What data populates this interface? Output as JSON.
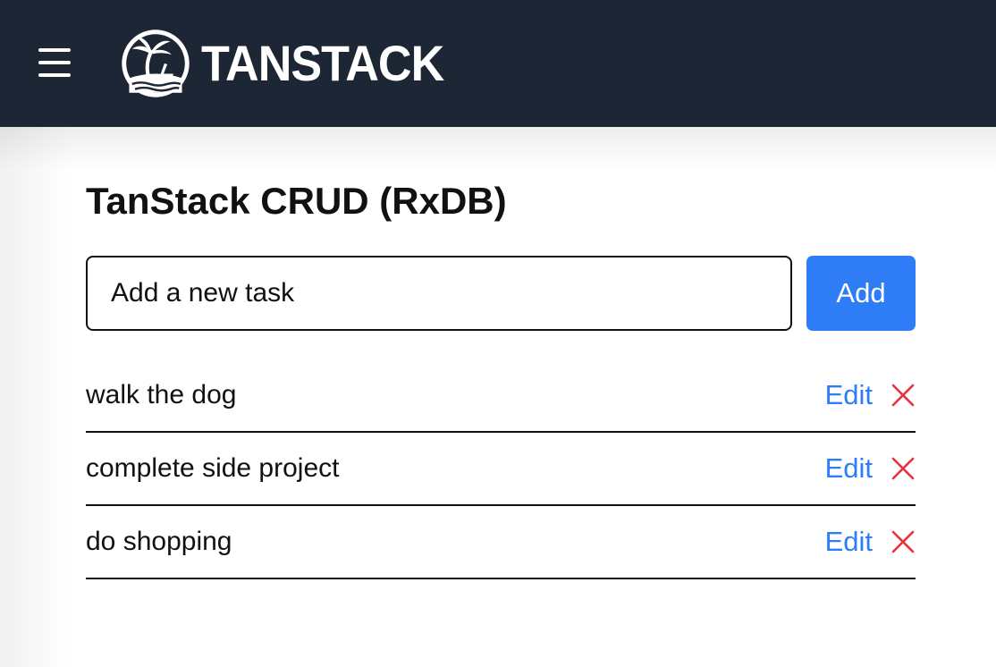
{
  "header": {
    "menu_icon": "hamburger-menu-icon",
    "logo_icon": "tanstack-island-palm-logo-icon",
    "logo_text": "TANSTACK",
    "background": "#1d2635"
  },
  "main": {
    "title": "TanStack CRUD (RxDB)",
    "new_task": {
      "value": "",
      "placeholder": "Add a new task"
    },
    "add_label": "Add",
    "accent_color": "#2e7cf6",
    "delete_color": "#e8323c",
    "tasks": [
      {
        "text": "walk the dog",
        "edit_label": "Edit",
        "delete_icon": "close-x-icon"
      },
      {
        "text": "complete side project",
        "edit_label": "Edit",
        "delete_icon": "close-x-icon"
      },
      {
        "text": "do shopping",
        "edit_label": "Edit",
        "delete_icon": "close-x-icon"
      }
    ]
  }
}
